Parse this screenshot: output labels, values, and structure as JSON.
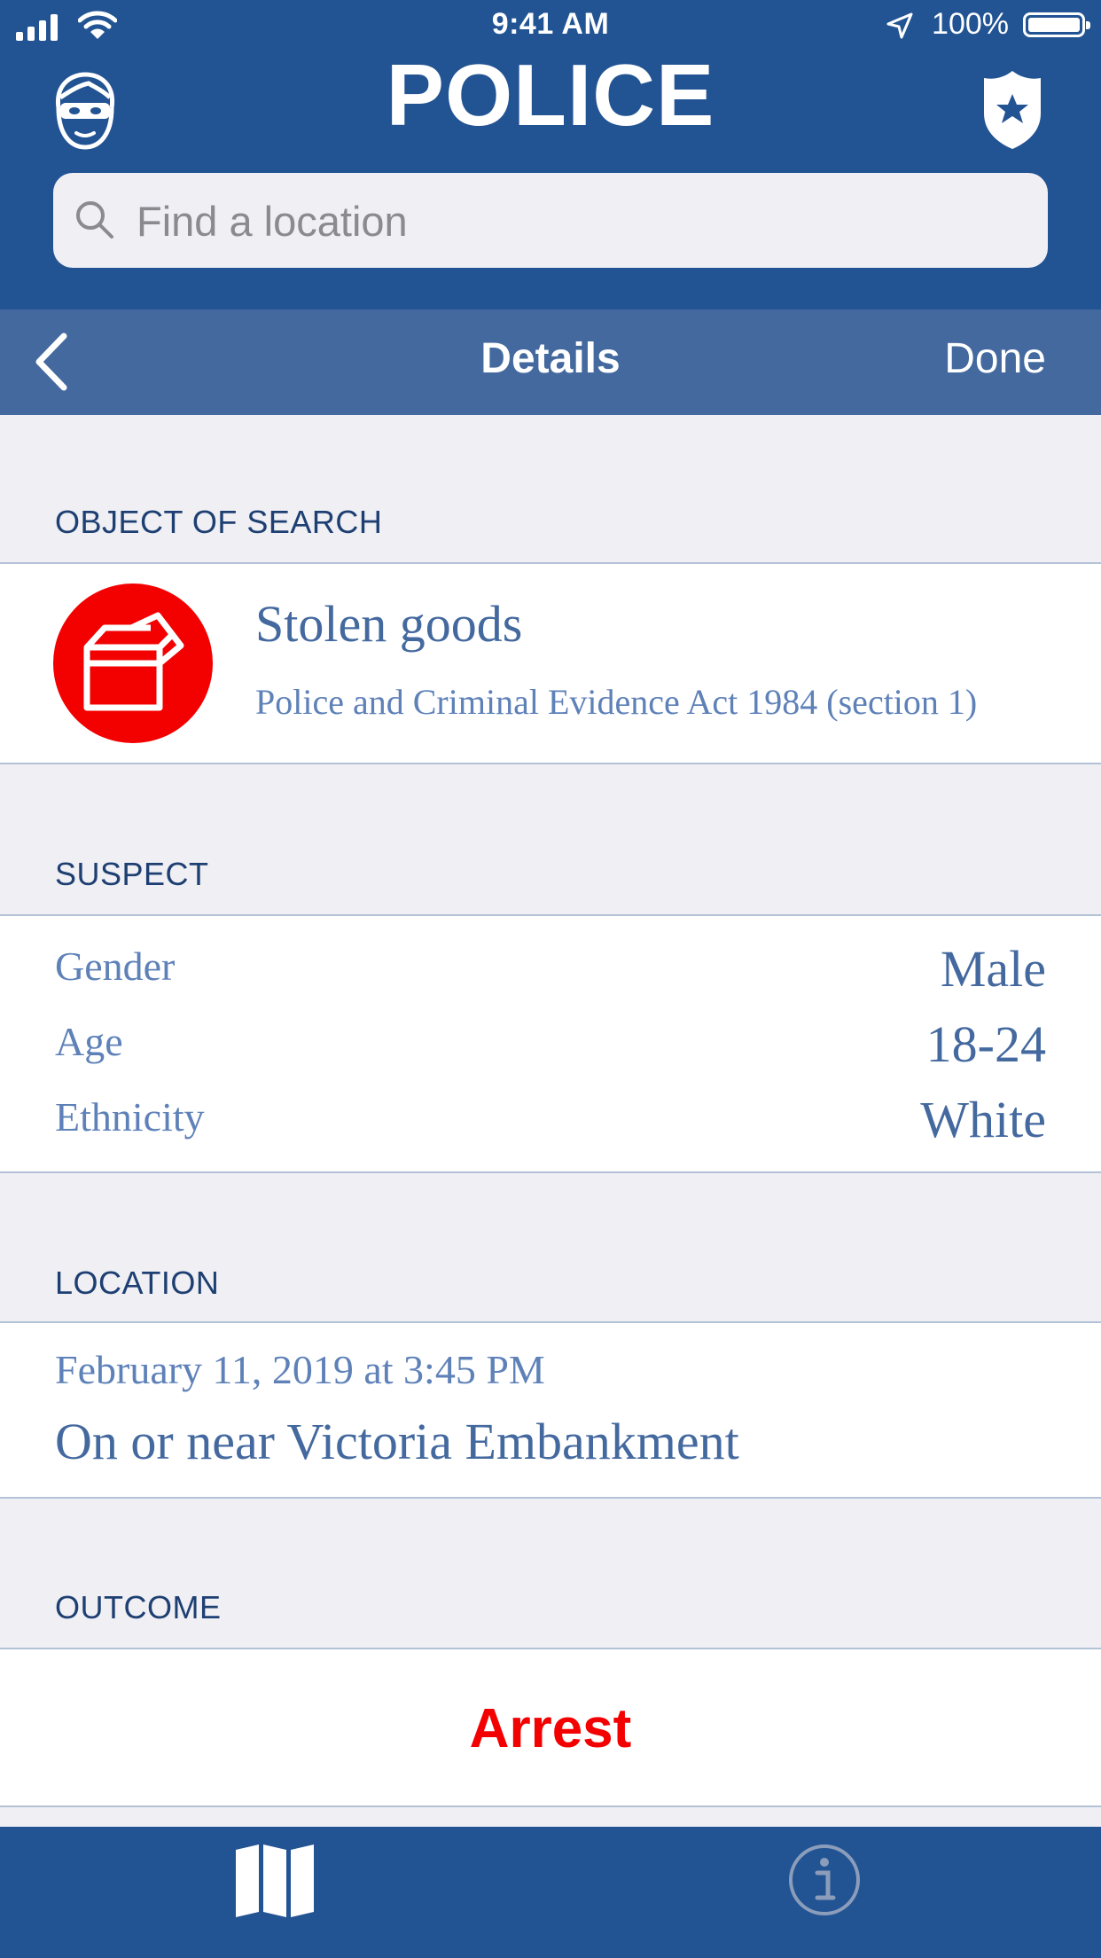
{
  "status_bar": {
    "time": "9:41 AM",
    "battery_percent": "100%",
    "icons": [
      "signal-icon",
      "wifi-icon",
      "location-arrow-icon",
      "battery-icon"
    ]
  },
  "header": {
    "title": "POLICE",
    "left_icon": "masked-face-icon",
    "right_icon": "police-badge-icon",
    "search": {
      "placeholder": "Find a location",
      "value": ""
    }
  },
  "nav": {
    "title": "Details",
    "done_label": "Done",
    "back_icon": "chevron-left-icon"
  },
  "object_of_search": {
    "header": "OBJECT OF SEARCH",
    "icon": "box-icon",
    "title": "Stolen goods",
    "subtitle": "Police and Criminal Evidence Act 1984 (section 1)"
  },
  "suspect": {
    "header": "SUSPECT",
    "rows": [
      {
        "label": "Gender",
        "value": "Male"
      },
      {
        "label": "Age",
        "value": "18-24"
      },
      {
        "label": "Ethnicity",
        "value": "White"
      }
    ]
  },
  "location": {
    "header": "LOCATION",
    "datetime": "February 11, 2019 at 3:45 PM",
    "place": "On or near Victoria Embankment"
  },
  "outcome": {
    "header": "OUTCOME",
    "value": "Arrest"
  },
  "tab_bar": {
    "items": [
      {
        "icon": "map-icon",
        "selected": true
      },
      {
        "icon": "info-icon",
        "selected": false
      }
    ]
  },
  "colors": {
    "brand_blue": "#225393",
    "nav_blue": "#44699f",
    "accent_red": "#f30000",
    "background": "#efeff4"
  }
}
